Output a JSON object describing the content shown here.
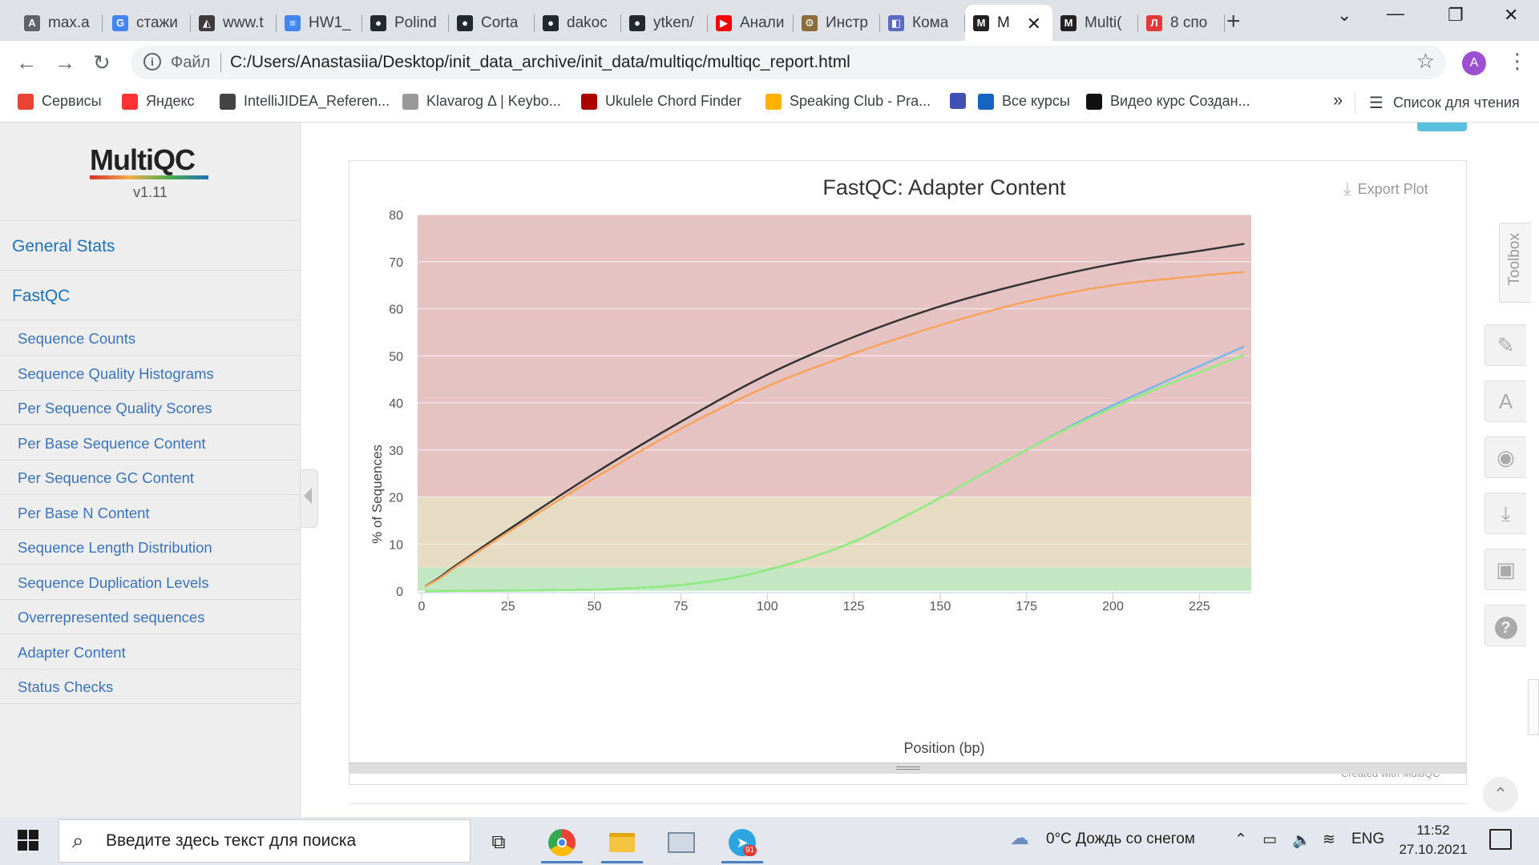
{
  "browser": {
    "tabs": [
      {
        "label": "max.a",
        "icon": "A",
        "color": "#5f6368"
      },
      {
        "label": "стажи",
        "icon": "G",
        "color": "#4285f4"
      },
      {
        "label": "www.t",
        "icon": "◭",
        "color": "#3c3c3c"
      },
      {
        "label": "HW1_",
        "icon": "≡",
        "color": "#4285f4"
      },
      {
        "label": "Polind",
        "icon": "●",
        "color": "#24292e"
      },
      {
        "label": "Corta",
        "icon": "●",
        "color": "#24292e"
      },
      {
        "label": "dakoc",
        "icon": "●",
        "color": "#24292e"
      },
      {
        "label": "ytken/",
        "icon": "●",
        "color": "#24292e"
      },
      {
        "label": "Анали",
        "icon": "▶",
        "color": "#ff0000"
      },
      {
        "label": "Инстр",
        "icon": "⚙",
        "color": "#8a6d3b"
      },
      {
        "label": "Кома",
        "icon": "◧",
        "color": "#5c6bc0"
      },
      {
        "label": "M",
        "icon": "M",
        "color": "#222"
      },
      {
        "label": "Multi(",
        "icon": "M",
        "color": "#222"
      },
      {
        "label": "8 спо",
        "icon": "Л",
        "color": "#e53935"
      }
    ],
    "new_tab": "+",
    "address": {
      "scheme": "Файл",
      "url": "C:/Users/Anastasiia/Desktop/init_data_archive/init_data/multiqc/multiqc_report.html"
    },
    "profile_initial": "A",
    "bookmarks": [
      {
        "label": "Сервисы",
        "color": "#ea4335"
      },
      {
        "label": "Яндекс",
        "color": "#ff3333"
      },
      {
        "label": "IntelliJIDEA_Referen...",
        "color": "#444"
      },
      {
        "label": "Klavarog Δ | Keybo...",
        "color": "#999"
      },
      {
        "label": "Ukulele Chord Finder",
        "color": "#a00"
      },
      {
        "label": "Speaking Club - Pra...",
        "color": "#ffb300"
      },
      {
        "label": "",
        "color": "#3f51b5"
      },
      {
        "label": "Все курсы",
        "color": "#1565c0"
      },
      {
        "label": "Видео курс Создан...",
        "color": "#111"
      }
    ],
    "bookmarks_more": "»",
    "reading_list": "Список для чтения"
  },
  "sidebar": {
    "logo": "MultiQC",
    "version": "v1.11",
    "main_items": [
      "General Stats",
      "FastQC"
    ],
    "sub_items": [
      "Sequence Counts",
      "Sequence Quality Histograms",
      "Per Sequence Quality Scores",
      "Per Base Sequence Content",
      "Per Sequence GC Content",
      "Per Base N Content",
      "Sequence Length Distribution",
      "Sequence Duplication Levels",
      "Overrepresented sequences",
      "Adapter Content",
      "Status Checks"
    ]
  },
  "plot": {
    "export_label": "Export Plot",
    "credit": "Created with MultiQC"
  },
  "chart_data": {
    "type": "line",
    "title": "FastQC: Adapter Content",
    "xlabel": "Position (bp)",
    "ylabel": "% of Sequences",
    "xlim": [
      0,
      240
    ],
    "ylim": [
      0,
      80
    ],
    "x_ticks": [
      0,
      25,
      50,
      75,
      100,
      125,
      150,
      175,
      200,
      225
    ],
    "y_ticks": [
      0,
      10,
      20,
      30,
      40,
      50,
      60,
      70,
      80
    ],
    "grid": true,
    "bands": [
      {
        "from": 0,
        "to": 5,
        "color": "#c3e6c3"
      },
      {
        "from": 5,
        "to": 20,
        "color": "#e6dcc3"
      },
      {
        "from": 20,
        "to": 80,
        "color": "#e6c3c3"
      }
    ],
    "series": [
      {
        "color": "#333333",
        "x": [
          1,
          5,
          10,
          25,
          50,
          75,
          100,
          125,
          150,
          175,
          200,
          225,
          238
        ],
        "y": [
          1,
          2.8,
          5.5,
          13,
          25,
          36,
          46,
          54,
          60.5,
          65.5,
          69.5,
          72.3,
          73.8
        ]
      },
      {
        "color": "#f7a35c",
        "x": [
          1,
          5,
          10,
          25,
          50,
          75,
          100,
          125,
          150,
          175,
          200,
          225,
          238
        ],
        "y": [
          1,
          2.6,
          5.2,
          12.5,
          24,
          34.5,
          43.5,
          50.5,
          56.5,
          61.5,
          65,
          67,
          67.8
        ]
      },
      {
        "color": "#7cb5ec",
        "x": [
          1,
          25,
          50,
          60,
          75,
          90,
          100,
          112,
          125,
          137,
          150,
          162,
          175,
          187,
          200,
          212,
          225,
          238
        ],
        "y": [
          0,
          0.1,
          0.3,
          0.6,
          1.3,
          2.8,
          4.5,
          7,
          10.5,
          14.8,
          19.8,
          24.8,
          30,
          34.8,
          39.5,
          43.5,
          47.8,
          52
        ]
      },
      {
        "color": "#90ed7d",
        "x": [
          1,
          25,
          50,
          60,
          75,
          90,
          100,
          112,
          125,
          137,
          150,
          162,
          175,
          187,
          200,
          212,
          225,
          238
        ],
        "y": [
          0,
          0.1,
          0.3,
          0.6,
          1.3,
          2.8,
          4.5,
          7,
          10.5,
          14.8,
          19.8,
          24.8,
          30,
          34.6,
          39,
          42.8,
          46.5,
          50.2
        ]
      }
    ]
  },
  "toolbox": {
    "label": "Toolbox",
    "buttons": [
      {
        "name": "highlight-samples-button",
        "icon": "pin-icon",
        "glyph": "✎"
      },
      {
        "name": "rename-samples-button",
        "icon": "font-icon",
        "glyph": "A"
      },
      {
        "name": "hide-samples-button",
        "icon": "eye-slash-icon",
        "glyph": "◉"
      },
      {
        "name": "export-plots-button",
        "icon": "download-icon",
        "glyph": "⤓"
      },
      {
        "name": "save-settings-button",
        "icon": "floppy-icon",
        "glyph": "▣"
      },
      {
        "name": "help-button",
        "icon": "question-icon",
        "glyph": "?"
      }
    ],
    "to_top": "⌃"
  },
  "taskbar": {
    "search_placeholder": "Введите здесь текст для поиска",
    "weather": "0°C  Дождь со снегом",
    "lang": "ENG",
    "time": "11:52",
    "date": "27.10.2021",
    "telegram_badge": "91"
  }
}
